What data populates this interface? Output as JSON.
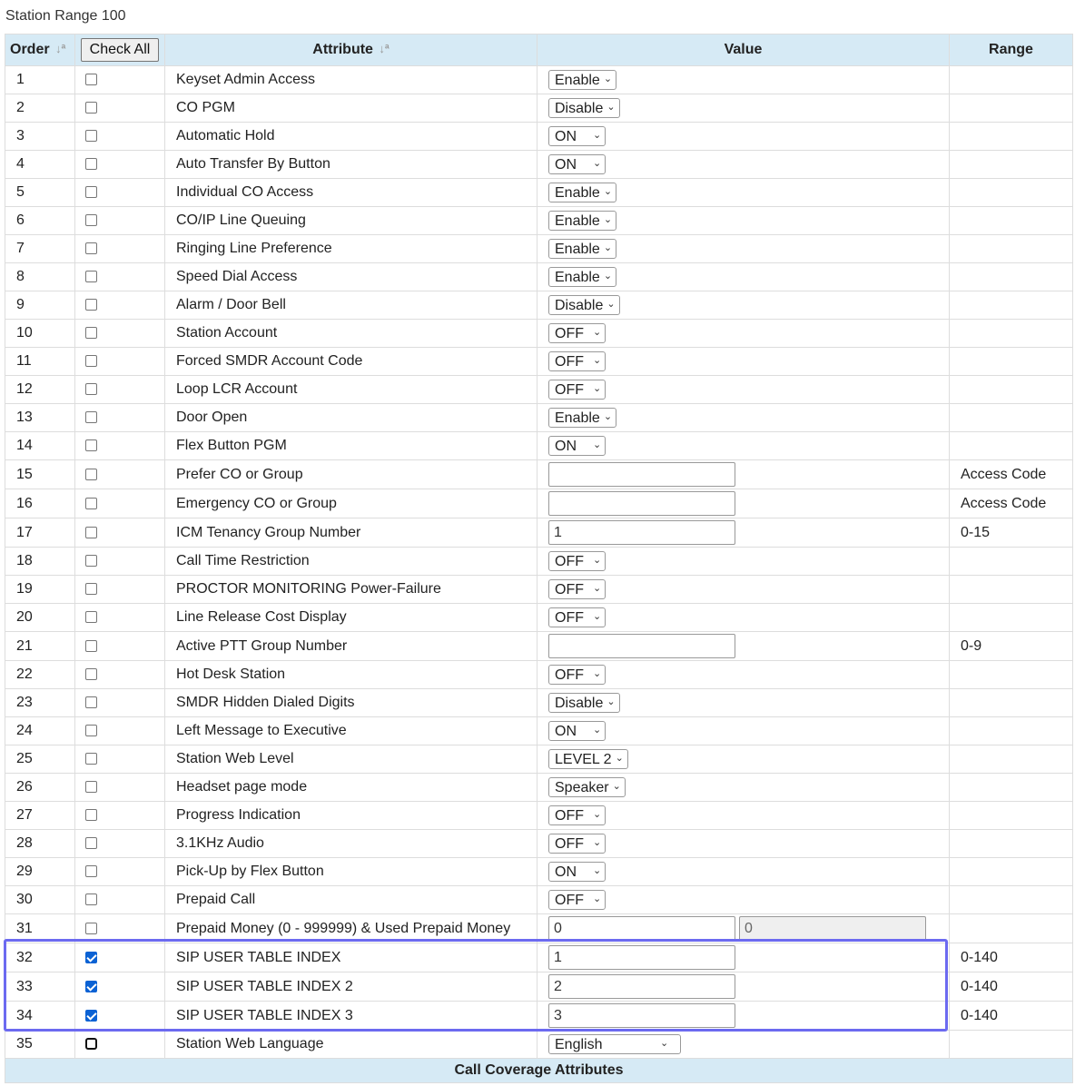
{
  "caption": "Station Range 100",
  "header": {
    "order": "Order",
    "check_all": "Check All",
    "attribute": "Attribute",
    "value": "Value",
    "range": "Range",
    "sort_icon": "↓ª"
  },
  "rows": [
    {
      "order": "1",
      "checked": false,
      "attr": "Keyset Admin Access",
      "type": "select",
      "value": "Enable",
      "range": ""
    },
    {
      "order": "2",
      "checked": false,
      "attr": "CO PGM",
      "type": "select",
      "value": "Disable",
      "range": ""
    },
    {
      "order": "3",
      "checked": false,
      "attr": "Automatic Hold",
      "type": "select",
      "value": "ON",
      "range": ""
    },
    {
      "order": "4",
      "checked": false,
      "attr": "Auto Transfer By Button",
      "type": "select",
      "value": "ON",
      "range": ""
    },
    {
      "order": "5",
      "checked": false,
      "attr": "Individual CO Access",
      "type": "select",
      "value": "Enable",
      "range": ""
    },
    {
      "order": "6",
      "checked": false,
      "attr": "CO/IP Line Queuing",
      "type": "select",
      "value": "Enable",
      "range": ""
    },
    {
      "order": "7",
      "checked": false,
      "attr": "Ringing Line Preference",
      "type": "select",
      "value": "Enable",
      "range": ""
    },
    {
      "order": "8",
      "checked": false,
      "attr": "Speed Dial Access",
      "type": "select",
      "value": "Enable",
      "range": ""
    },
    {
      "order": "9",
      "checked": false,
      "attr": "Alarm / Door Bell",
      "type": "select",
      "value": "Disable",
      "range": ""
    },
    {
      "order": "10",
      "checked": false,
      "attr": "Station Account",
      "type": "select",
      "value": "OFF",
      "range": ""
    },
    {
      "order": "11",
      "checked": false,
      "attr": "Forced SMDR Account Code",
      "type": "select",
      "value": "OFF",
      "range": ""
    },
    {
      "order": "12",
      "checked": false,
      "attr": "Loop LCR Account",
      "type": "select",
      "value": "OFF",
      "range": ""
    },
    {
      "order": "13",
      "checked": false,
      "attr": "Door Open",
      "type": "select",
      "value": "Enable",
      "range": ""
    },
    {
      "order": "14",
      "checked": false,
      "attr": "Flex Button PGM",
      "type": "select",
      "value": "ON",
      "range": ""
    },
    {
      "order": "15",
      "checked": false,
      "attr": "Prefer CO or Group",
      "type": "input",
      "value": "",
      "range": "Access Code"
    },
    {
      "order": "16",
      "checked": false,
      "attr": "Emergency CO or Group",
      "type": "input",
      "value": "",
      "range": "Access Code"
    },
    {
      "order": "17",
      "checked": false,
      "attr": "ICM Tenancy Group Number",
      "type": "input",
      "value": "1",
      "range": "0-15"
    },
    {
      "order": "18",
      "checked": false,
      "attr": "Call Time Restriction",
      "type": "select",
      "value": "OFF",
      "range": ""
    },
    {
      "order": "19",
      "checked": false,
      "attr": "PROCTOR MONITORING Power-Failure",
      "type": "select",
      "value": "OFF",
      "range": ""
    },
    {
      "order": "20",
      "checked": false,
      "attr": "Line Release Cost Display",
      "type": "select",
      "value": "OFF",
      "range": ""
    },
    {
      "order": "21",
      "checked": false,
      "attr": "Active PTT Group Number",
      "type": "input",
      "value": "",
      "range": "0-9"
    },
    {
      "order": "22",
      "checked": false,
      "attr": "Hot Desk Station",
      "type": "select",
      "value": "OFF",
      "range": ""
    },
    {
      "order": "23",
      "checked": false,
      "attr": "SMDR Hidden Dialed Digits",
      "type": "select",
      "value": "Disable",
      "range": ""
    },
    {
      "order": "24",
      "checked": false,
      "attr": "Left Message to Executive",
      "type": "select",
      "value": "ON",
      "range": ""
    },
    {
      "order": "25",
      "checked": false,
      "attr": "Station Web Level",
      "type": "select",
      "value": "LEVEL 2",
      "range": ""
    },
    {
      "order": "26",
      "checked": false,
      "attr": "Headset page mode",
      "type": "select",
      "value": "Speaker",
      "range": ""
    },
    {
      "order": "27",
      "checked": false,
      "attr": "Progress Indication",
      "type": "select",
      "value": "OFF",
      "range": ""
    },
    {
      "order": "28",
      "checked": false,
      "attr": "3.1KHz Audio",
      "type": "select",
      "value": "OFF",
      "range": ""
    },
    {
      "order": "29",
      "checked": false,
      "attr": "Pick-Up by Flex Button",
      "type": "select",
      "value": "ON",
      "range": ""
    },
    {
      "order": "30",
      "checked": false,
      "attr": "Prepaid Call",
      "type": "select",
      "value": "OFF",
      "range": ""
    },
    {
      "order": "31",
      "checked": false,
      "attr": "Prepaid Money (0 - 999999) & Used Prepaid Money",
      "type": "input2",
      "value": "0",
      "value2": "0",
      "range": ""
    },
    {
      "order": "32",
      "checked": true,
      "attr": "SIP USER TABLE INDEX",
      "type": "input",
      "value": "1",
      "range": "0-140"
    },
    {
      "order": "33",
      "checked": true,
      "attr": "SIP USER TABLE INDEX 2",
      "type": "input",
      "value": "2",
      "range": "0-140"
    },
    {
      "order": "34",
      "checked": true,
      "attr": "SIP USER TABLE INDEX 3",
      "type": "input",
      "value": "3",
      "range": "0-140"
    },
    {
      "order": "35",
      "checked": false,
      "attr": "Station Web Language",
      "type": "select",
      "value": "English",
      "range": ""
    }
  ],
  "footer": "Call Coverage Attributes",
  "colors": {
    "header_bg": "#d6eaf5",
    "highlight": "#6c6af0",
    "checkbox_checked": "#0b62d4"
  }
}
